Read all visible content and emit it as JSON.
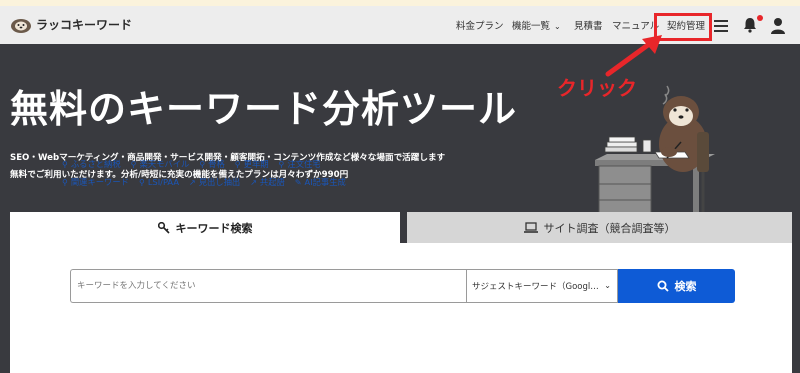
{
  "header": {
    "brand": "ラッコキーワード",
    "nav": [
      {
        "label": "料金プラン"
      },
      {
        "label": "機能一覧"
      },
      {
        "label": "見積書"
      },
      {
        "label": "マニュアル"
      },
      {
        "label": "契約管理"
      }
    ],
    "icons": [
      "menu-icon",
      "bell-icon",
      "user-icon"
    ],
    "notification_dot_color": "#e8262a"
  },
  "hero": {
    "title": "無料のキーワード分析ツール",
    "subtitle_line1": "SEO・Webマーケティング・商品開発・サービス開発・顧客開拓・コンテンツ作成など様々な場面で活躍します",
    "subtitle_line2": "無料でご利用いただけます。分析/時短に充実の機能を備えたプランは月々わずか990円",
    "annotation": "クリック"
  },
  "tabs": [
    {
      "label": "キーワード検索",
      "icon": "key-icon",
      "active": true
    },
    {
      "label": "サイト調査（競合調査等）",
      "icon": "laptop-icon",
      "active": false
    }
  ],
  "search": {
    "placeholder": "キーワードを入力してください",
    "select_value": "サジェストキーワード（Googl…",
    "button_label": "検索"
  },
  "quick_links_row1": [
    "ふるさと納税",
    "楽天モバイル",
    "骨格",
    "更年期",
    "注文住宅"
  ],
  "quick_links_row2": [
    "関連キーワード",
    "LSI/PAA",
    "見出し抽出",
    "共起語",
    "AI記事生成"
  ],
  "colors": {
    "hero_bg": "#393a3f",
    "accent_blue": "#0e5bd6",
    "highlight_red": "#e8262a"
  }
}
